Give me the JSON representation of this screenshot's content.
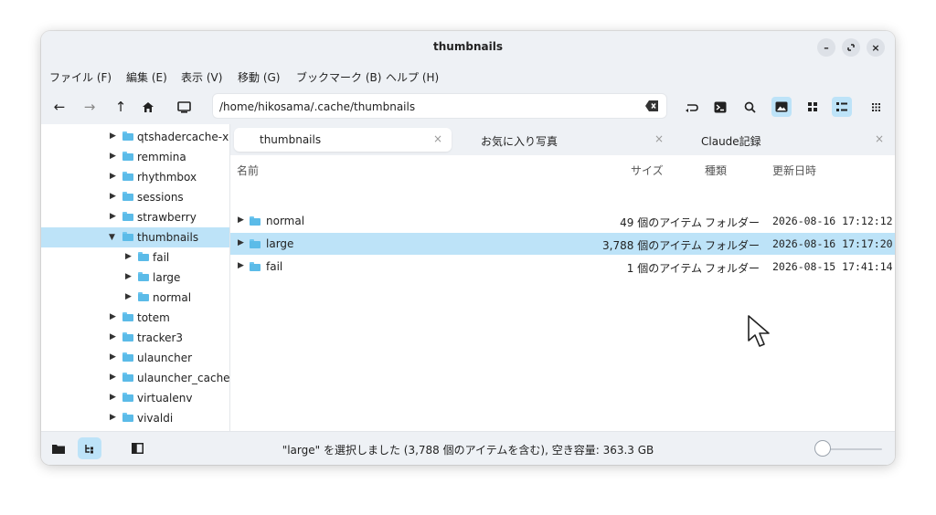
{
  "window": {
    "title": "thumbnails"
  },
  "menu": [
    "ファイル (F)",
    "編集 (E)",
    "表示 (V)",
    "移動 (G)",
    "ブックマーク (B)",
    "ヘルプ (H)"
  ],
  "toolbar": {
    "path": "/home/hikosama/.cache/thumbnails",
    "icons": [
      "back-arrow-icon",
      "forward-arrow-icon",
      "up-arrow-icon",
      "home-icon",
      "computer-icon",
      "clear-icon",
      "undo-icon",
      "terminal-icon",
      "search-icon",
      "image-view-icon",
      "grid-view-icon",
      "list-view-icon",
      "compact-view-icon"
    ]
  },
  "sidebar": {
    "items": [
      {
        "label": "qtshadercache-x",
        "indent": 1,
        "expanded": false,
        "selected": false
      },
      {
        "label": "remmina",
        "indent": 1,
        "expanded": false,
        "selected": false
      },
      {
        "label": "rhythmbox",
        "indent": 1,
        "expanded": false,
        "selected": false
      },
      {
        "label": "sessions",
        "indent": 1,
        "expanded": false,
        "selected": false
      },
      {
        "label": "strawberry",
        "indent": 1,
        "expanded": false,
        "selected": false
      },
      {
        "label": "thumbnails",
        "indent": 1,
        "expanded": true,
        "selected": true
      },
      {
        "label": "fail",
        "indent": 2,
        "expanded": false,
        "selected": false
      },
      {
        "label": "large",
        "indent": 2,
        "expanded": false,
        "selected": false
      },
      {
        "label": "normal",
        "indent": 2,
        "expanded": false,
        "selected": false
      },
      {
        "label": "totem",
        "indent": 1,
        "expanded": false,
        "selected": false
      },
      {
        "label": "tracker3",
        "indent": 1,
        "expanded": false,
        "selected": false
      },
      {
        "label": "ulauncher",
        "indent": 1,
        "expanded": false,
        "selected": false
      },
      {
        "label": "ulauncher_cache",
        "indent": 1,
        "expanded": false,
        "selected": false
      },
      {
        "label": "virtualenv",
        "indent": 1,
        "expanded": false,
        "selected": false
      },
      {
        "label": "vivaldi",
        "indent": 1,
        "expanded": false,
        "selected": false
      }
    ]
  },
  "tabs": [
    {
      "label": "thumbnails",
      "close": "×",
      "active": true
    },
    {
      "label": "お気に入り写真",
      "close": "×",
      "active": false
    },
    {
      "label": "Claude記録",
      "close": "×",
      "active": false
    }
  ],
  "columns": {
    "name": "名前",
    "size": "サイズ",
    "kind": "種類",
    "modified": "更新日時"
  },
  "rows": [
    {
      "name": "normal",
      "size": "49 個のアイテム",
      "kind": "フォルダー",
      "modified": "2026-08-16 17:12:12",
      "selected": false
    },
    {
      "name": "large",
      "size": "3,788 個のアイテム",
      "kind": "フォルダー",
      "modified": "2026-08-16 17:17:20",
      "selected": true
    },
    {
      "name": "fail",
      "size": "1 個のアイテム",
      "kind": "フォルダー",
      "modified": "2026-08-15 17:41:14",
      "selected": false
    }
  ],
  "statusbar": {
    "text": "\"large\" を選択しました (3,788 個のアイテムを含む), 空き容量: 363.3 GB",
    "zoom_level": 0.0
  },
  "colors": {
    "accent": "#bde3f8",
    "folder": "#5bbbe8",
    "chrome": "#eef1f5"
  }
}
